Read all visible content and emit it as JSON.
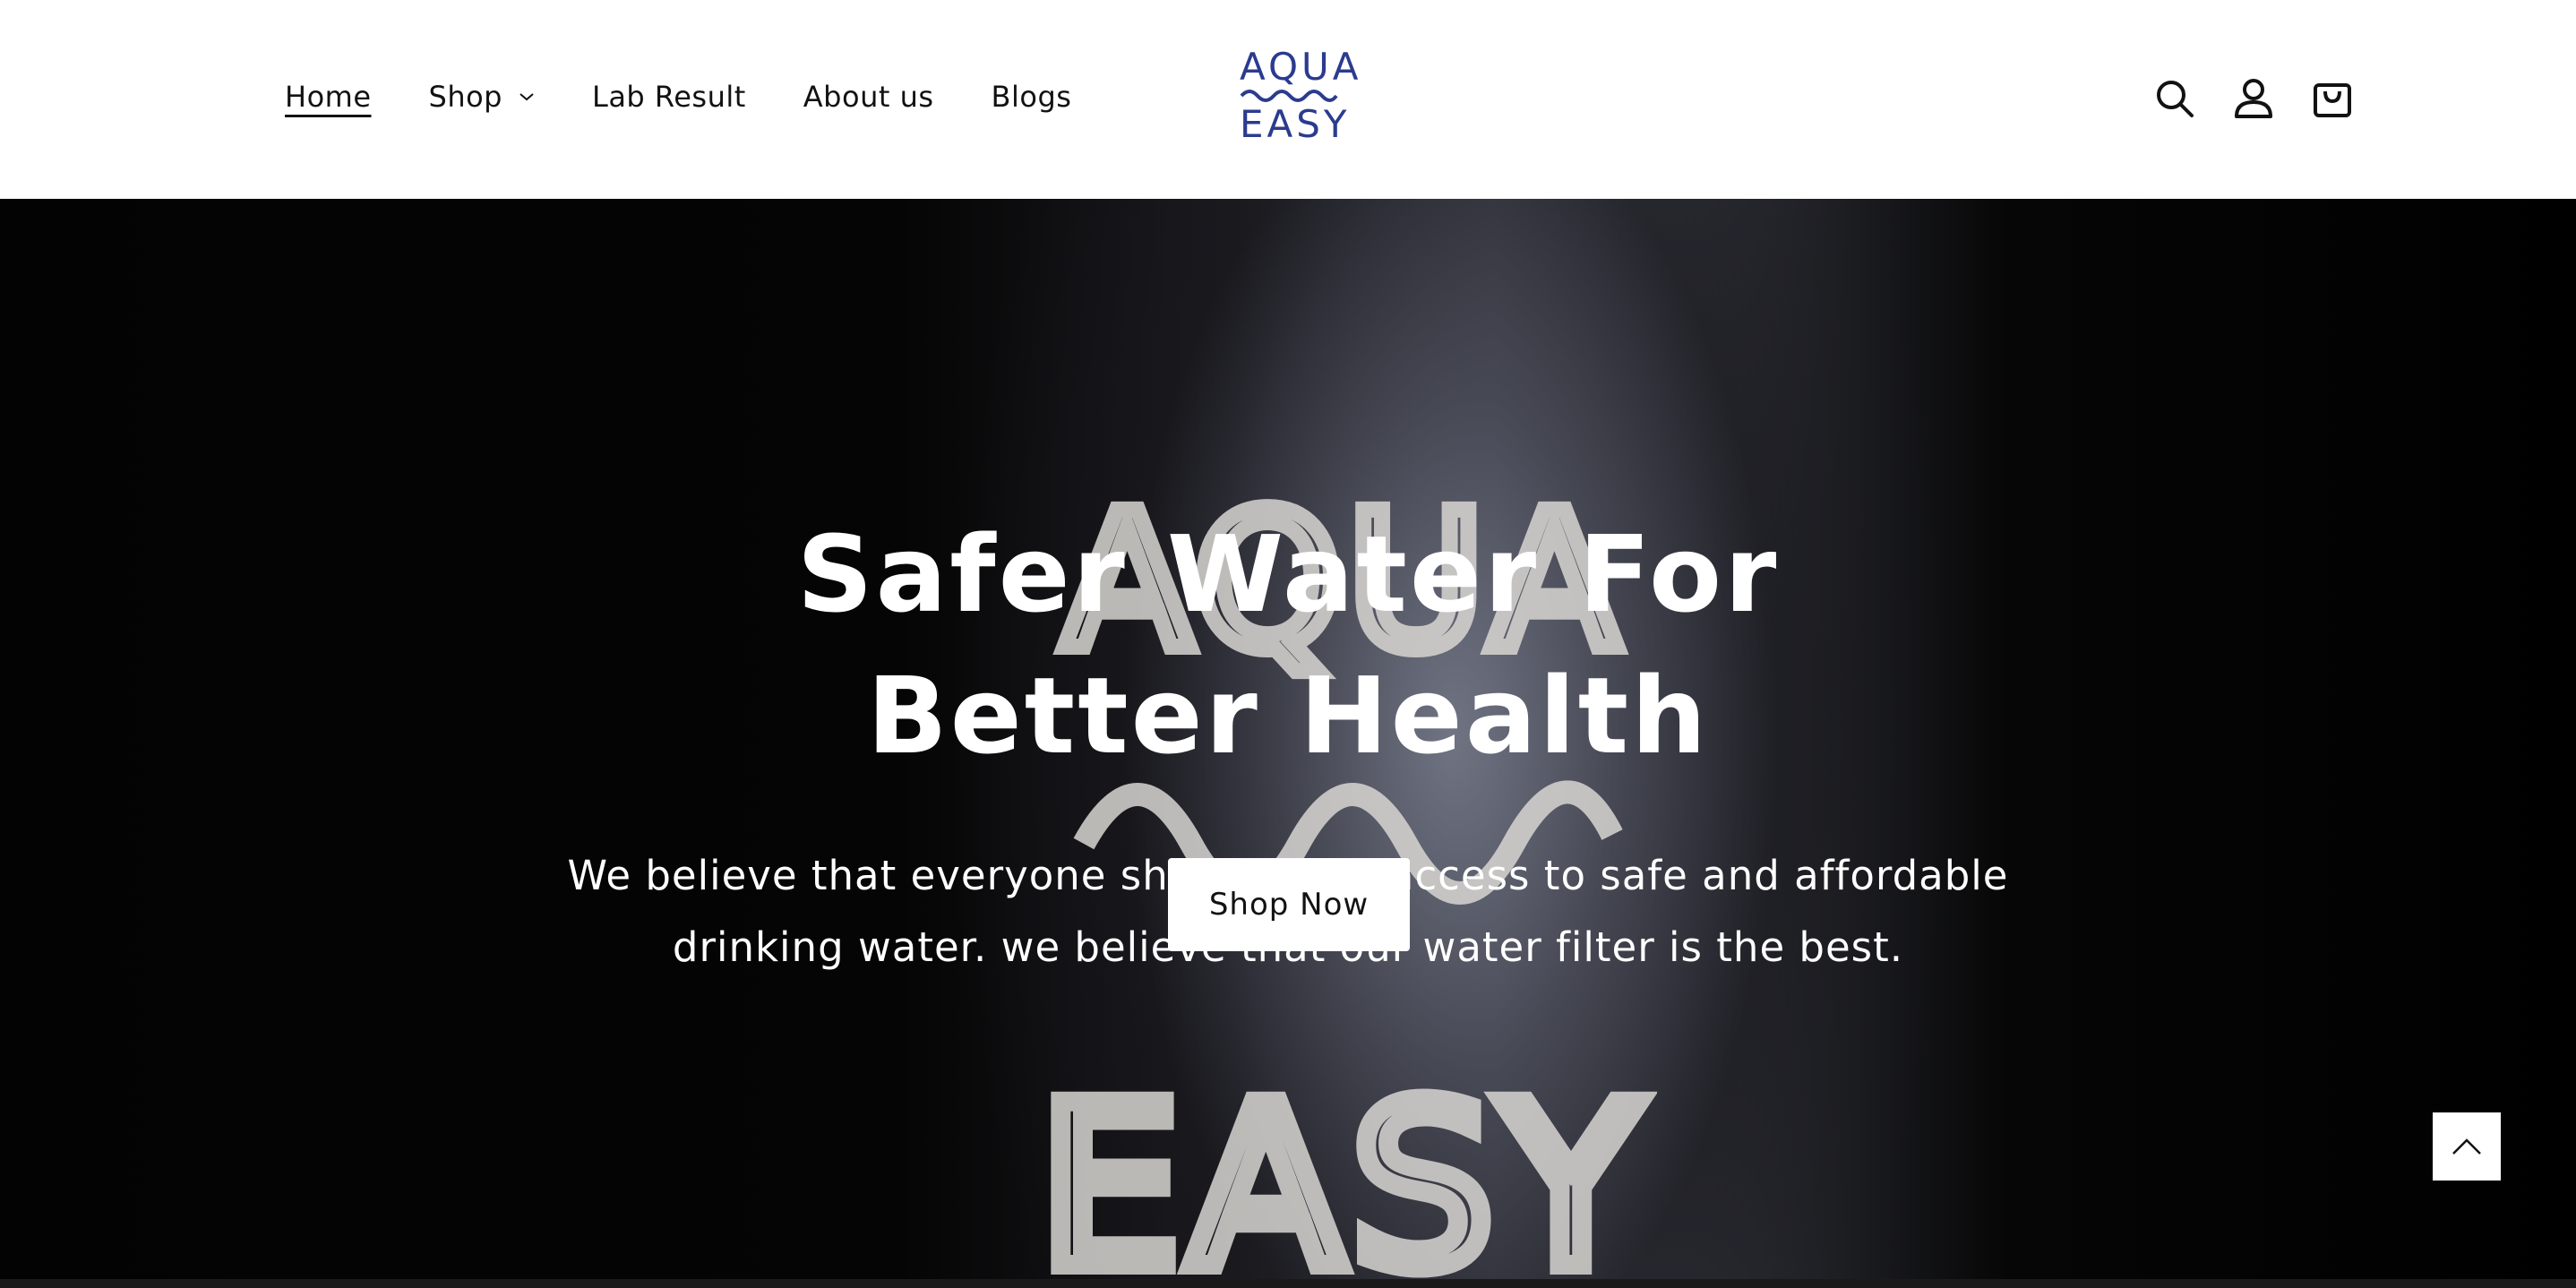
{
  "nav": {
    "items": [
      {
        "label": "Home",
        "active": true
      },
      {
        "label": "Shop",
        "has_dropdown": true
      },
      {
        "label": "Lab Result"
      },
      {
        "label": "About us"
      },
      {
        "label": "Blogs"
      }
    ]
  },
  "logo": {
    "line1": "AQUA",
    "line2": "EASY",
    "color": "#2b3b8f"
  },
  "header_icons": [
    "search-icon",
    "account-icon",
    "cart-icon"
  ],
  "hero": {
    "title": "Safer Water For Better Health",
    "subtitle": "We believe that everyone should have access to safe and affordable drinking water. we believe that our water filter is the best.",
    "cta_label": "Shop Now",
    "background_mark_line1": "AQUA",
    "background_mark_line2": "EASY"
  },
  "scroll_top_icon": "chevron-up-icon"
}
